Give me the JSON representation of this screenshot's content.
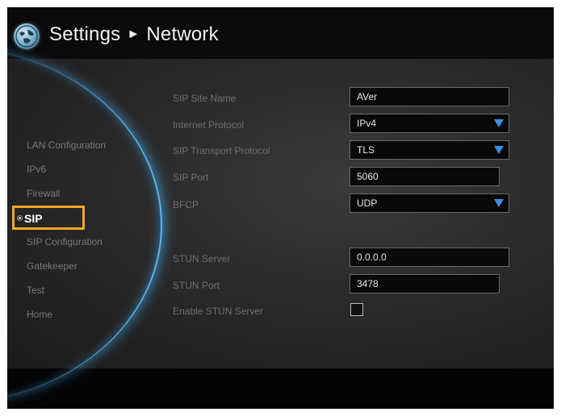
{
  "header": {
    "title": "Settings",
    "separator": "►",
    "subtitle": "Network",
    "logo_icon": "globe-logo-icon"
  },
  "nav": {
    "items": [
      {
        "label": "LAN Configuration"
      },
      {
        "label": "IPv6"
      },
      {
        "label": "Firewall"
      },
      {
        "label": "SIP"
      },
      {
        "label": "SIP Configuration"
      },
      {
        "label": "Gatekeeper"
      },
      {
        "label": "Test"
      },
      {
        "label": "Home"
      }
    ],
    "selected_index": 3
  },
  "form": {
    "sip_site_name": {
      "label": "SIP Site Name",
      "value": "AVer"
    },
    "internet_protocol": {
      "label": "Internet Protocol",
      "value": "IPv4"
    },
    "sip_transport_protocol": {
      "label": "SIP Transport Protocol",
      "value": "TLS"
    },
    "sip_port": {
      "label": "SIP Port",
      "value": "5060"
    },
    "bfcp": {
      "label": "BFCP",
      "value": "UDP"
    },
    "stun_server": {
      "label": "STUN Server",
      "value": "0.0.0.0"
    },
    "stun_port": {
      "label": "STUN Port",
      "value": "3478"
    },
    "enable_stun_server": {
      "label": "Enable STUN Server",
      "checked": false
    }
  },
  "colors": {
    "accent_highlight": "#f5a623",
    "dropdown_caret": "#3c8ee6",
    "arc_glow": "#5ab8ec"
  }
}
